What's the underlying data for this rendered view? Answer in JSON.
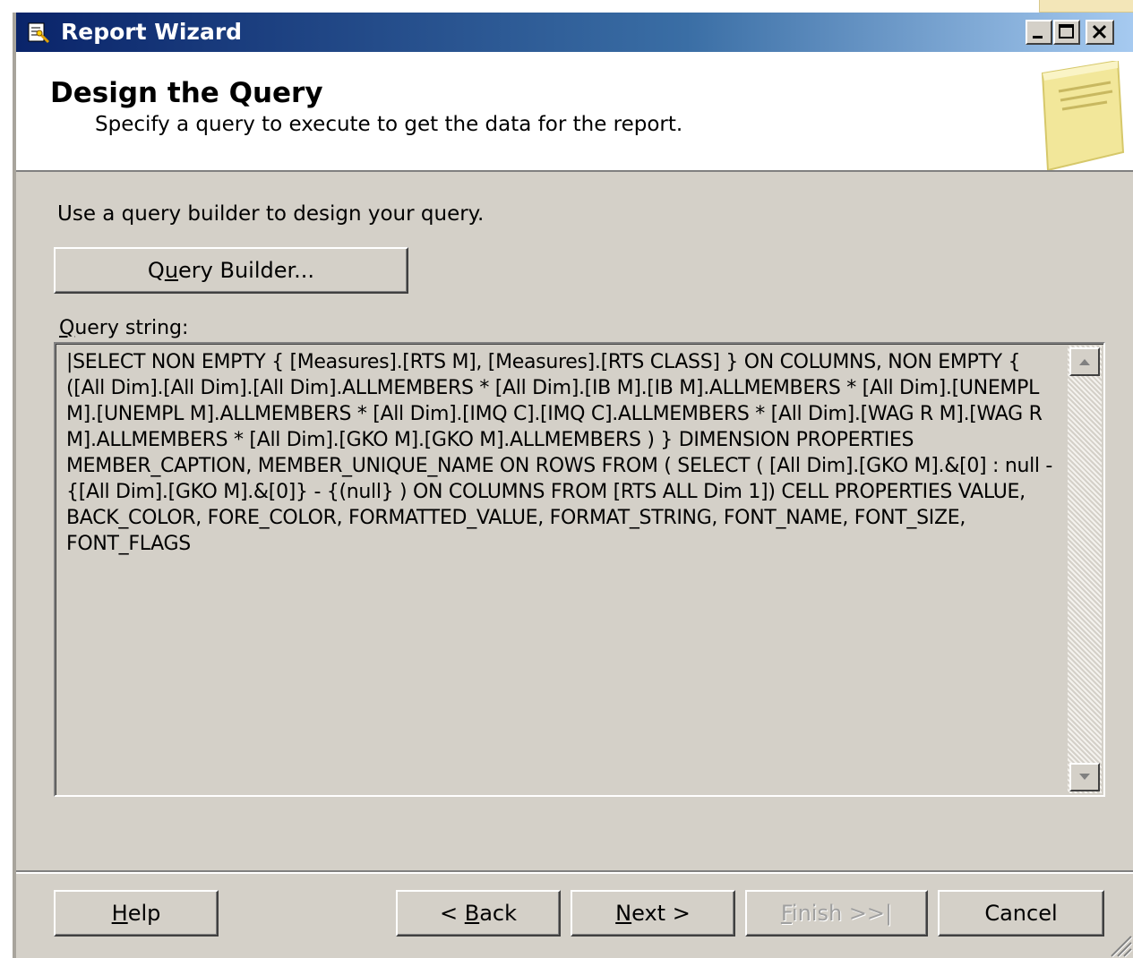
{
  "window": {
    "title": "Report Wizard"
  },
  "header": {
    "title": "Design the Query",
    "subtitle": "Specify a query to execute to get the data for the report."
  },
  "body": {
    "instruction": "Use a query builder to design your query.",
    "query_builder_button": {
      "pre": "Q",
      "mnemonic": "u",
      "post": "ery Builder..."
    },
    "query_string_label": {
      "pre": "",
      "mnemonic": "Q",
      "post": "uery string:"
    },
    "query_string": "|SELECT NON EMPTY { [Measures].[RTS M], [Measures].[RTS CLASS] } ON COLUMNS, NON EMPTY { ([All Dim].[All Dim].[All Dim].ALLMEMBERS * [All Dim].[IB M].[IB M].ALLMEMBERS * [All Dim].[UNEMPL M].[UNEMPL M].ALLMEMBERS * [All Dim].[IMQ C].[IMQ C].ALLMEMBERS * [All Dim].[WAG R M].[WAG R M].ALLMEMBERS * [All Dim].[GKO M].[GKO M].ALLMEMBERS ) } DIMENSION PROPERTIES MEMBER_CAPTION, MEMBER_UNIQUE_NAME ON ROWS FROM ( SELECT ( [All Dim].[GKO M].&[0] : null - {[All Dim].[GKO M].&[0]} - {(null} ) ON COLUMNS FROM [RTS ALL Dim 1]) CELL PROPERTIES VALUE, BACK_COLOR, FORE_COLOR, FORMATTED_VALUE, FORMAT_STRING, FONT_NAME, FONT_SIZE, FONT_FLAGS"
  },
  "footer": {
    "help": {
      "pre": "",
      "mnemonic": "H",
      "post": "elp"
    },
    "back": {
      "pre": "< ",
      "mnemonic": "B",
      "post": "ack"
    },
    "next": {
      "pre": "",
      "mnemonic": "N",
      "post": "ext >"
    },
    "finish": {
      "pre": "",
      "mnemonic": "F",
      "post": "inish >>|",
      "enabled": false
    },
    "cancel": "Cancel"
  },
  "icons": {
    "app": "report-wizard-icon",
    "header": "note-document-icon"
  },
  "colors": {
    "titlebar_start": "#0a246a",
    "titlebar_end": "#a6caf0",
    "dialog_face": "#d4d0c8",
    "disabled_text": "#a0a0a0"
  }
}
